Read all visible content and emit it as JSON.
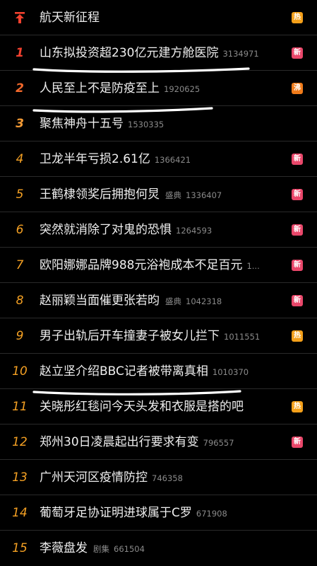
{
  "colors": {
    "new_badge": "#e9476a",
    "hot_badge": "#f4a01a",
    "boil_badge": "#f07b1a",
    "pin_icon": "#f3412f",
    "underline": "#ffffff"
  },
  "items": [
    {
      "rank": "",
      "pinned": true,
      "title": "航天新征程",
      "tag": "",
      "count": "",
      "badge": "热",
      "badge_type": "hot"
    },
    {
      "rank": "1",
      "title": "山东拟投资超230亿元建方舱医院",
      "tag": "",
      "count": "3134971",
      "badge": "新",
      "badge_type": "new"
    },
    {
      "rank": "2",
      "title": "人民至上不是防疫至上",
      "tag": "",
      "count": "1920625",
      "badge": "沸",
      "badge_type": "boil"
    },
    {
      "rank": "3",
      "title": "聚焦神舟十五号",
      "tag": "",
      "count": "1530335",
      "badge": "",
      "badge_type": ""
    },
    {
      "rank": "4",
      "title": "卫龙半年亏损2.61亿",
      "tag": "",
      "count": "1366421",
      "badge": "新",
      "badge_type": "new"
    },
    {
      "rank": "5",
      "title": "王鹤棣领奖后拥抱何炅",
      "tag": "盛典",
      "count": "1336407",
      "badge": "新",
      "badge_type": "new"
    },
    {
      "rank": "6",
      "title": "突然就消除了对鬼的恐惧",
      "tag": "",
      "count": "1264593",
      "badge": "新",
      "badge_type": "new"
    },
    {
      "rank": "7",
      "title": "欧阳娜娜品牌988元浴袍成本不足百元",
      "tag": "",
      "count": "1...",
      "badge": "新",
      "badge_type": "new"
    },
    {
      "rank": "8",
      "title": "赵丽颖当面催更张若昀",
      "tag": "盛典",
      "count": "1042318",
      "badge": "新",
      "badge_type": "new"
    },
    {
      "rank": "9",
      "title": "男子出轨后开车撞妻子被女儿拦下",
      "tag": "",
      "count": "1011551",
      "badge": "热",
      "badge_type": "hot"
    },
    {
      "rank": "10",
      "title": "赵立坚介绍BBC记者被带离真相",
      "tag": "",
      "count": "1010370",
      "badge": "",
      "badge_type": ""
    },
    {
      "rank": "11",
      "title": "关晓彤红毯问今天头发和衣服是搭的吧",
      "tag": "",
      "count": "",
      "badge": "热",
      "badge_type": "hot"
    },
    {
      "rank": "12",
      "title": "郑州30日凌晨起出行要求有变",
      "tag": "",
      "count": "796557",
      "badge": "新",
      "badge_type": "new"
    },
    {
      "rank": "13",
      "title": "广州天河区疫情防控",
      "tag": "",
      "count": "746358",
      "badge": "",
      "badge_type": ""
    },
    {
      "rank": "14",
      "title": "葡萄牙足协证明进球属于C罗",
      "tag": "",
      "count": "671908",
      "badge": "",
      "badge_type": ""
    },
    {
      "rank": "15",
      "title": "李薇盘发",
      "tag": "剧集",
      "count": "661504",
      "badge": "",
      "badge_type": ""
    }
  ]
}
